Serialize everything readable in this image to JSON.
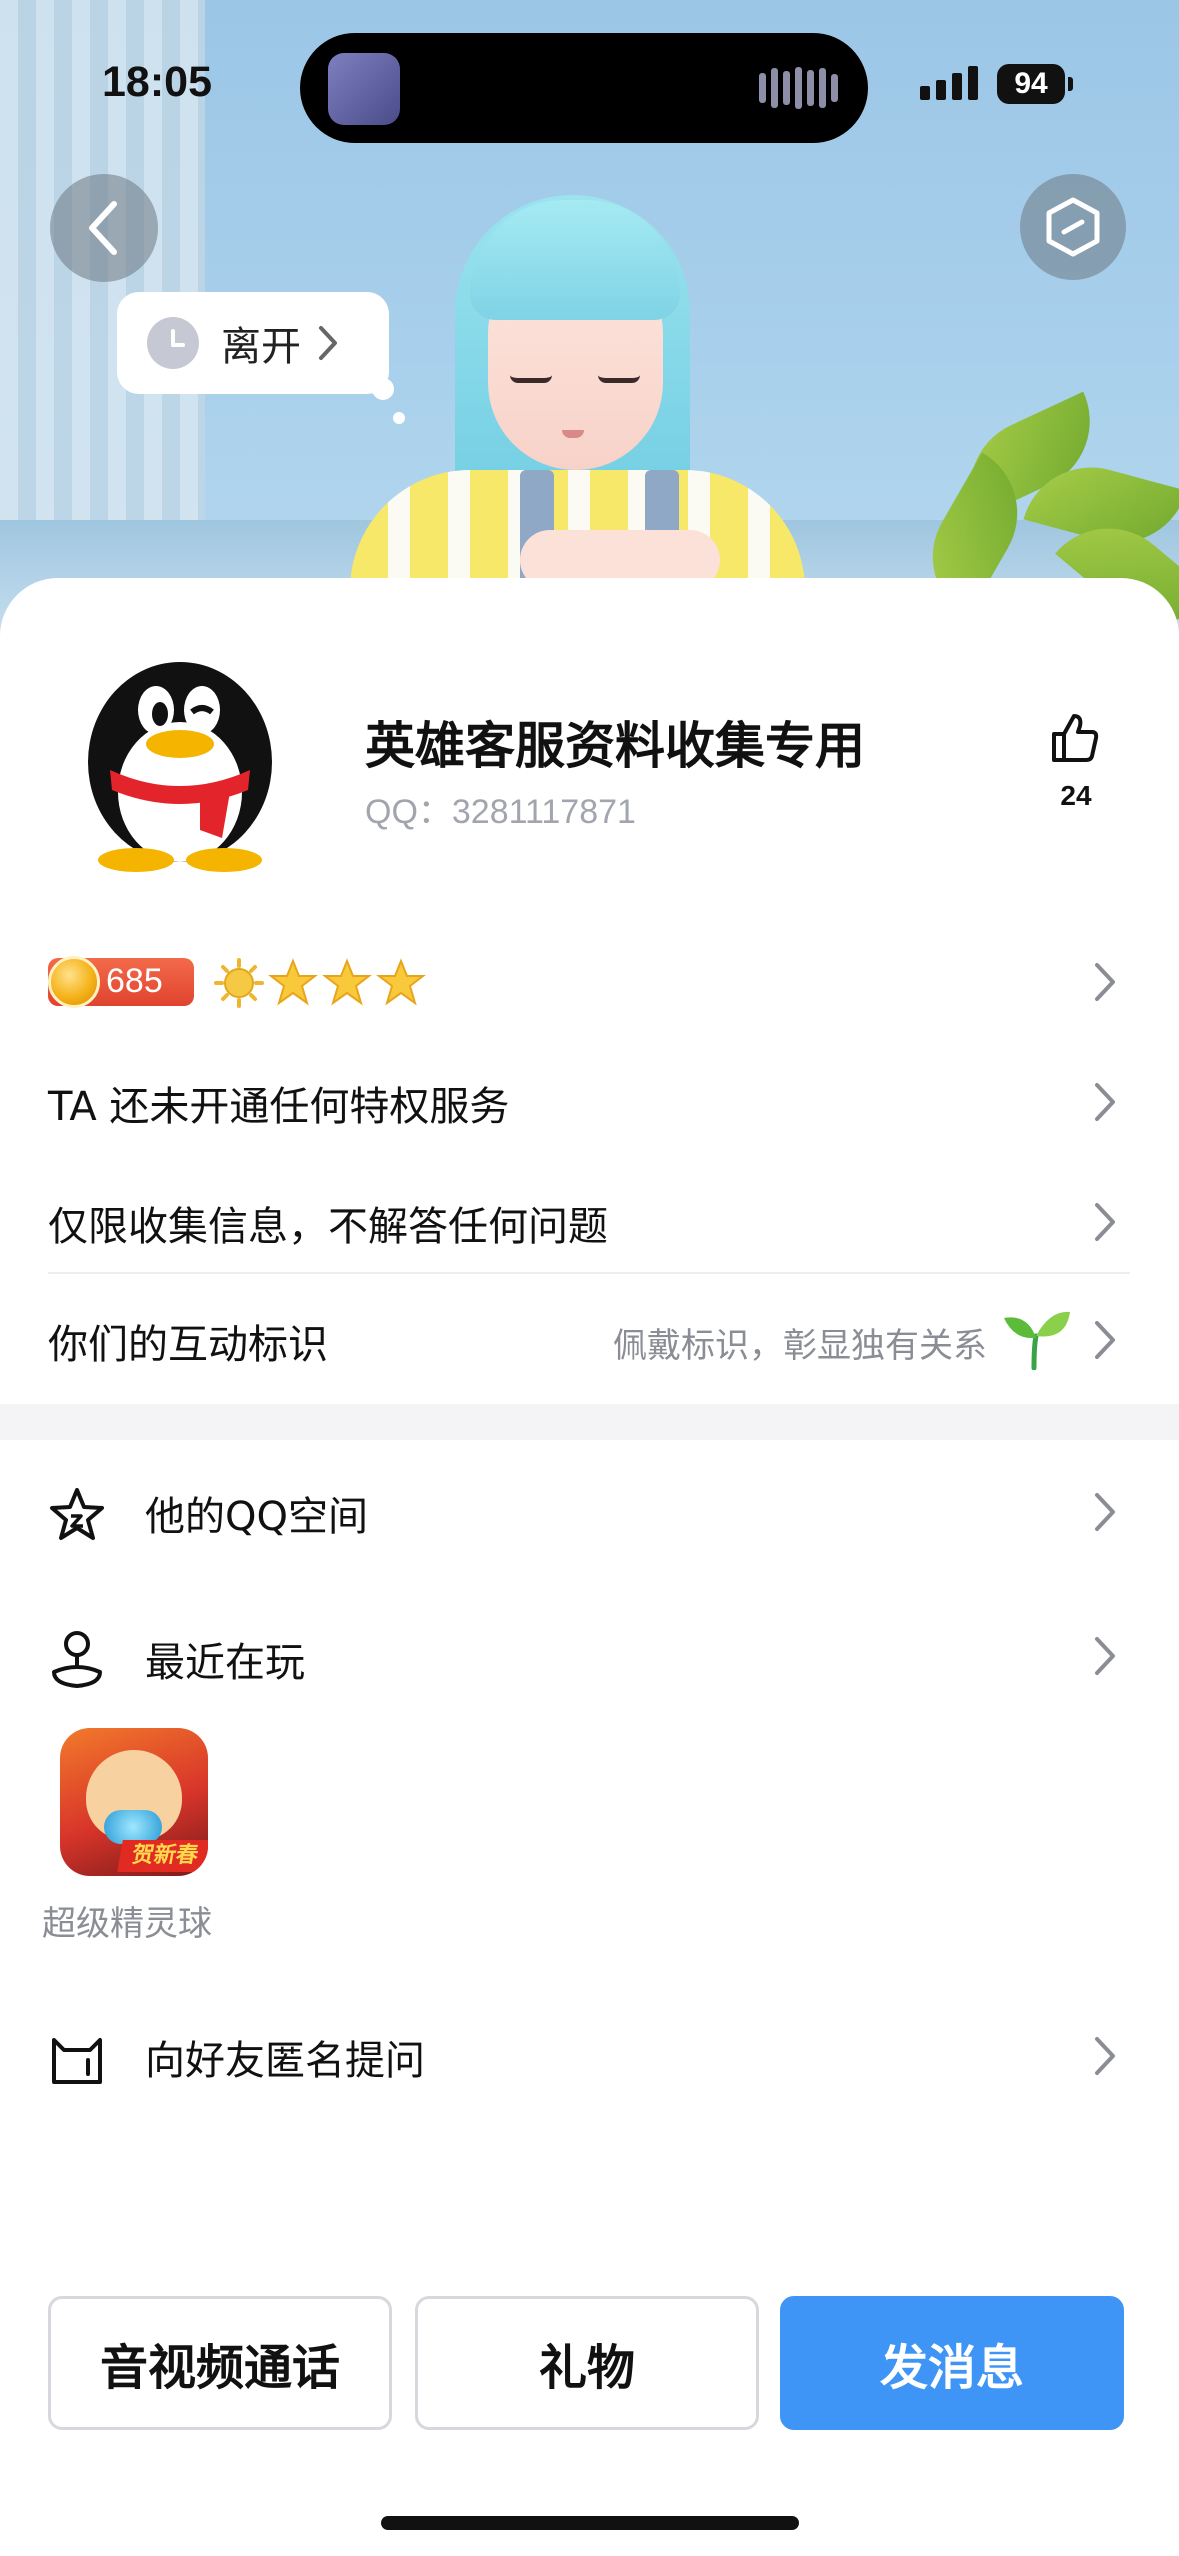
{
  "status_bar": {
    "time": "18:05",
    "battery": "94",
    "icons": [
      "signal-icon",
      "battery-icon"
    ]
  },
  "header": {
    "back_icon": "chevron-left-icon",
    "settings_icon": "hexagon-settings-icon",
    "status_bubble": {
      "label": "离开",
      "icon": "clock-icon"
    }
  },
  "profile": {
    "name": "英雄客服资料收集专用",
    "qq_id": "QQ：3281117871",
    "avatar_icon": "qq-penguin-icon",
    "likes": {
      "icon": "thumbs-up-icon",
      "count": "24"
    }
  },
  "level_row": {
    "coin_value": "685",
    "badges": [
      "sun-icon",
      "star-icon",
      "star-icon",
      "star-icon"
    ]
  },
  "info_rows": [
    {
      "label": "TA 还未开通任何特权服务"
    },
    {
      "label": "仅限收集信息，不解答任何问题"
    },
    {
      "label": "你们的互动标识",
      "sub": "佩戴标识，彰显独有关系",
      "icon": "sprout-icon"
    }
  ],
  "menu": {
    "qzone": {
      "label": "他的QQ空间",
      "icon": "star-outline-icon"
    },
    "recent_play": {
      "label": "最近在玩",
      "icon": "joystick-icon"
    },
    "game": {
      "name": "超级精灵球",
      "badge": "贺新春"
    },
    "anon_ask": {
      "label": "向好友匿名提问",
      "icon": "cat-box-icon"
    }
  },
  "actions": {
    "call": "音视频通话",
    "gift": "礼物",
    "message": "发消息"
  },
  "colors": {
    "primary": "#3f95f5",
    "secondary_text": "#8a8d94",
    "coin_badge": "#e0432f"
  }
}
